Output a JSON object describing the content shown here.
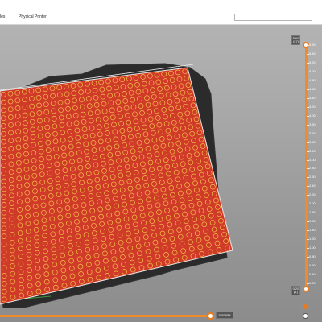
{
  "topbar": {
    "tab_partial_label": "les",
    "tab_physical_label": "Physical Printer",
    "search_value": ""
  },
  "vertical_slider": {
    "top_value": "5.60",
    "top_layer": "(27)",
    "bottom_value": "0.20",
    "bottom_layer": "(1)",
    "ticks": [
      "5.60",
      "5.40",
      "5.20",
      "5.00",
      "4.80",
      "4.60",
      "4.40",
      "4.20",
      "4.00",
      "3.80",
      "3.60",
      "3.40",
      "3.20",
      "3.00",
      "2.80",
      "2.60",
      "2.40",
      "2.20",
      "2.00",
      "1.80",
      "1.60",
      "1.40",
      "1.20",
      "1.00",
      "0.80",
      "0.60",
      "0.40",
      "0.20"
    ]
  },
  "horizontal_slider": {
    "value": "1557654",
    "position_fraction": 1.0
  },
  "colors": {
    "accent": "#ea7a1c",
    "print_red": "#d03a28",
    "circle_yellow": "#f2c04a",
    "bed_dark": "#2b2b2b"
  },
  "icons": {
    "settings": "cog-icon",
    "legend": "circle-icon"
  }
}
